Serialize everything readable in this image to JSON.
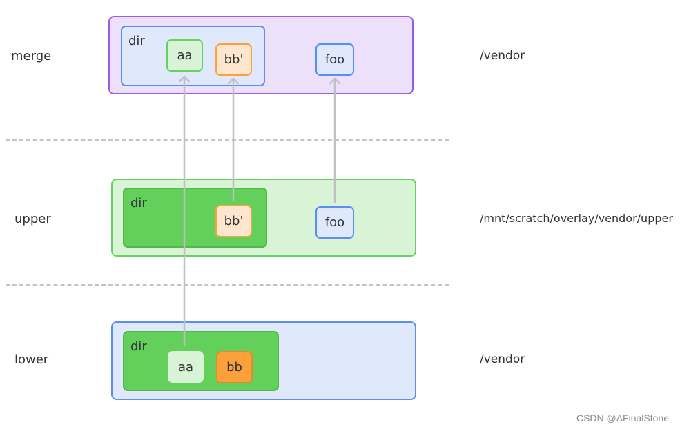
{
  "layers": {
    "merge": {
      "label": "merge",
      "path": "/vendor",
      "dir_label": "dir",
      "files_in_dir": [
        "aa",
        "bb'"
      ],
      "files": [
        "foo"
      ]
    },
    "upper": {
      "label": "upper",
      "path": "/mnt/scratch/overlay/vendor/upper",
      "dir_label": "dir",
      "files_in_dir": [
        "bb'"
      ],
      "files": [
        "foo"
      ]
    },
    "lower": {
      "label": "lower",
      "path": "/vendor",
      "dir_label": "dir",
      "files_in_dir": [
        "aa",
        "bb"
      ],
      "files": []
    }
  },
  "arrows": [
    {
      "from": "lower/dir/aa",
      "to": "merge/dir/aa"
    },
    {
      "from": "upper/dir/bb'",
      "to": "merge/dir/bb'"
    },
    {
      "from": "upper/foo",
      "to": "merge/foo"
    }
  ],
  "colors": {
    "merge_fill": "#ece0fb",
    "merge_border": "#9b5de5",
    "upper_fill": "#d8f3d6",
    "upper_border": "#68d060",
    "lower_fill": "#e0e8fc",
    "lower_border": "#5b8ef0",
    "dir_green": "#62d05a",
    "file_orange": "#fca03c",
    "arrow": "#c0c0c4"
  },
  "credit": "CSDN @AFinalStone"
}
